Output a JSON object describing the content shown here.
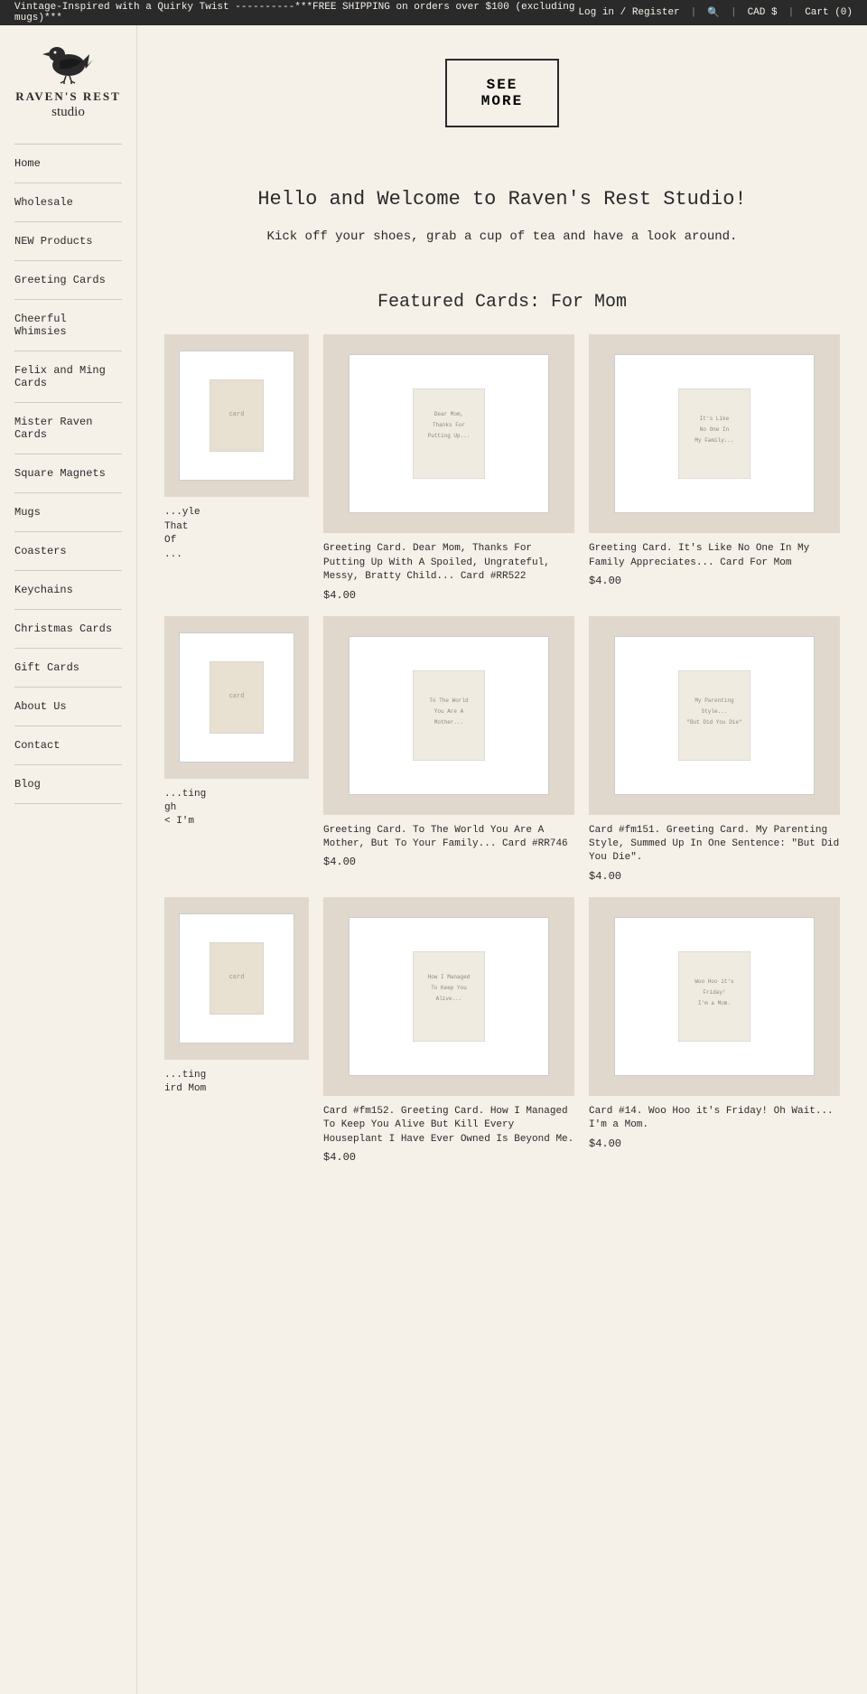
{
  "announcementBar": {
    "promoText": "Vintage-Inspired with a Quirky Twist ----------***FREE SHIPPING on orders over $100 (excluding mugs)***",
    "loginLabel": "Log in / Register",
    "searchIcon": "search-icon",
    "currency": "CAD $",
    "cartLabel": "Cart (0)"
  },
  "logo": {
    "mainText": "RAVEN'S REST",
    "subText": "studio",
    "altText": "Raven's Rest Studio Logo"
  },
  "nav": {
    "items": [
      {
        "label": "Home",
        "id": "home"
      },
      {
        "label": "Wholesale",
        "id": "wholesale"
      },
      {
        "label": "NEW Products",
        "id": "new-products"
      },
      {
        "label": "Greeting Cards",
        "id": "greeting-cards"
      },
      {
        "label": "Cheerful Whimsies",
        "id": "cheerful-whimsies"
      },
      {
        "label": "Felix and Ming Cards",
        "id": "felix-ming-cards"
      },
      {
        "label": "Mister Raven Cards",
        "id": "mister-raven-cards"
      },
      {
        "label": "Square Magnets",
        "id": "square-magnets"
      },
      {
        "label": "Mugs",
        "id": "mugs"
      },
      {
        "label": "Coasters",
        "id": "coasters"
      },
      {
        "label": "Keychains",
        "id": "keychains"
      },
      {
        "label": "Christmas Cards",
        "id": "christmas-cards"
      },
      {
        "label": "Gift Cards",
        "id": "gift-cards"
      },
      {
        "label": "About Us",
        "id": "about-us"
      },
      {
        "label": "Contact",
        "id": "contact"
      },
      {
        "label": "Blog",
        "id": "blog"
      }
    ]
  },
  "hero": {
    "seeMoreLine1": "SEE",
    "seeMoreLine2": "MORE",
    "seeMoreLabel": "SEE MORE"
  },
  "welcome": {
    "heading": "Hello and Welcome to Raven's Rest Studio!",
    "body": "Kick off your shoes, grab a cup of tea and have a look around."
  },
  "featured": {
    "heading": "Featured Cards: For Mom",
    "products": [
      {
        "id": "rr522",
        "title": "Greeting Card. Dear Mom, Thanks For Putting Up With A Spoiled, Ungrateful, Messy, Bratty Child... Card #RR522",
        "price": "$4.00"
      },
      {
        "id": "family-appreciates",
        "title": "Greeting Card. It's Like No One In My Family Appreciates... Card For Mom",
        "price": "$4.00"
      },
      {
        "id": "rr746",
        "title": "Greeting Card. To The World You Are A Mother, But To Your Family... Card #RR746",
        "price": "$4.00"
      },
      {
        "id": "fm151",
        "title": "Card #fm151. Greeting Card. My Parenting Style, Summed Up In One Sentence: \"But Did You Die\".",
        "price": "$4.00"
      },
      {
        "id": "fm152",
        "title": "Card #fm152. Greeting Card. How I Managed To Keep You Alive But Kill Every Houseplant I Have Ever Owned Is Beyond Me.",
        "price": "$4.00"
      },
      {
        "id": "card14",
        "title": "Card #14. Woo Hoo it's Friday! Oh Wait... I'm a Mom.",
        "price": "$4.00"
      }
    ],
    "partialLeft1": {
      "titleFragment": "...yle That Of ...",
      "hasImage": true
    },
    "partialLeft2": {
      "titleFragment": "...ting gh < I'm ird Mom",
      "hasImage": true
    },
    "partialLeft3": {
      "titleFragment": "...ting ird Mom",
      "hasImage": true
    }
  }
}
